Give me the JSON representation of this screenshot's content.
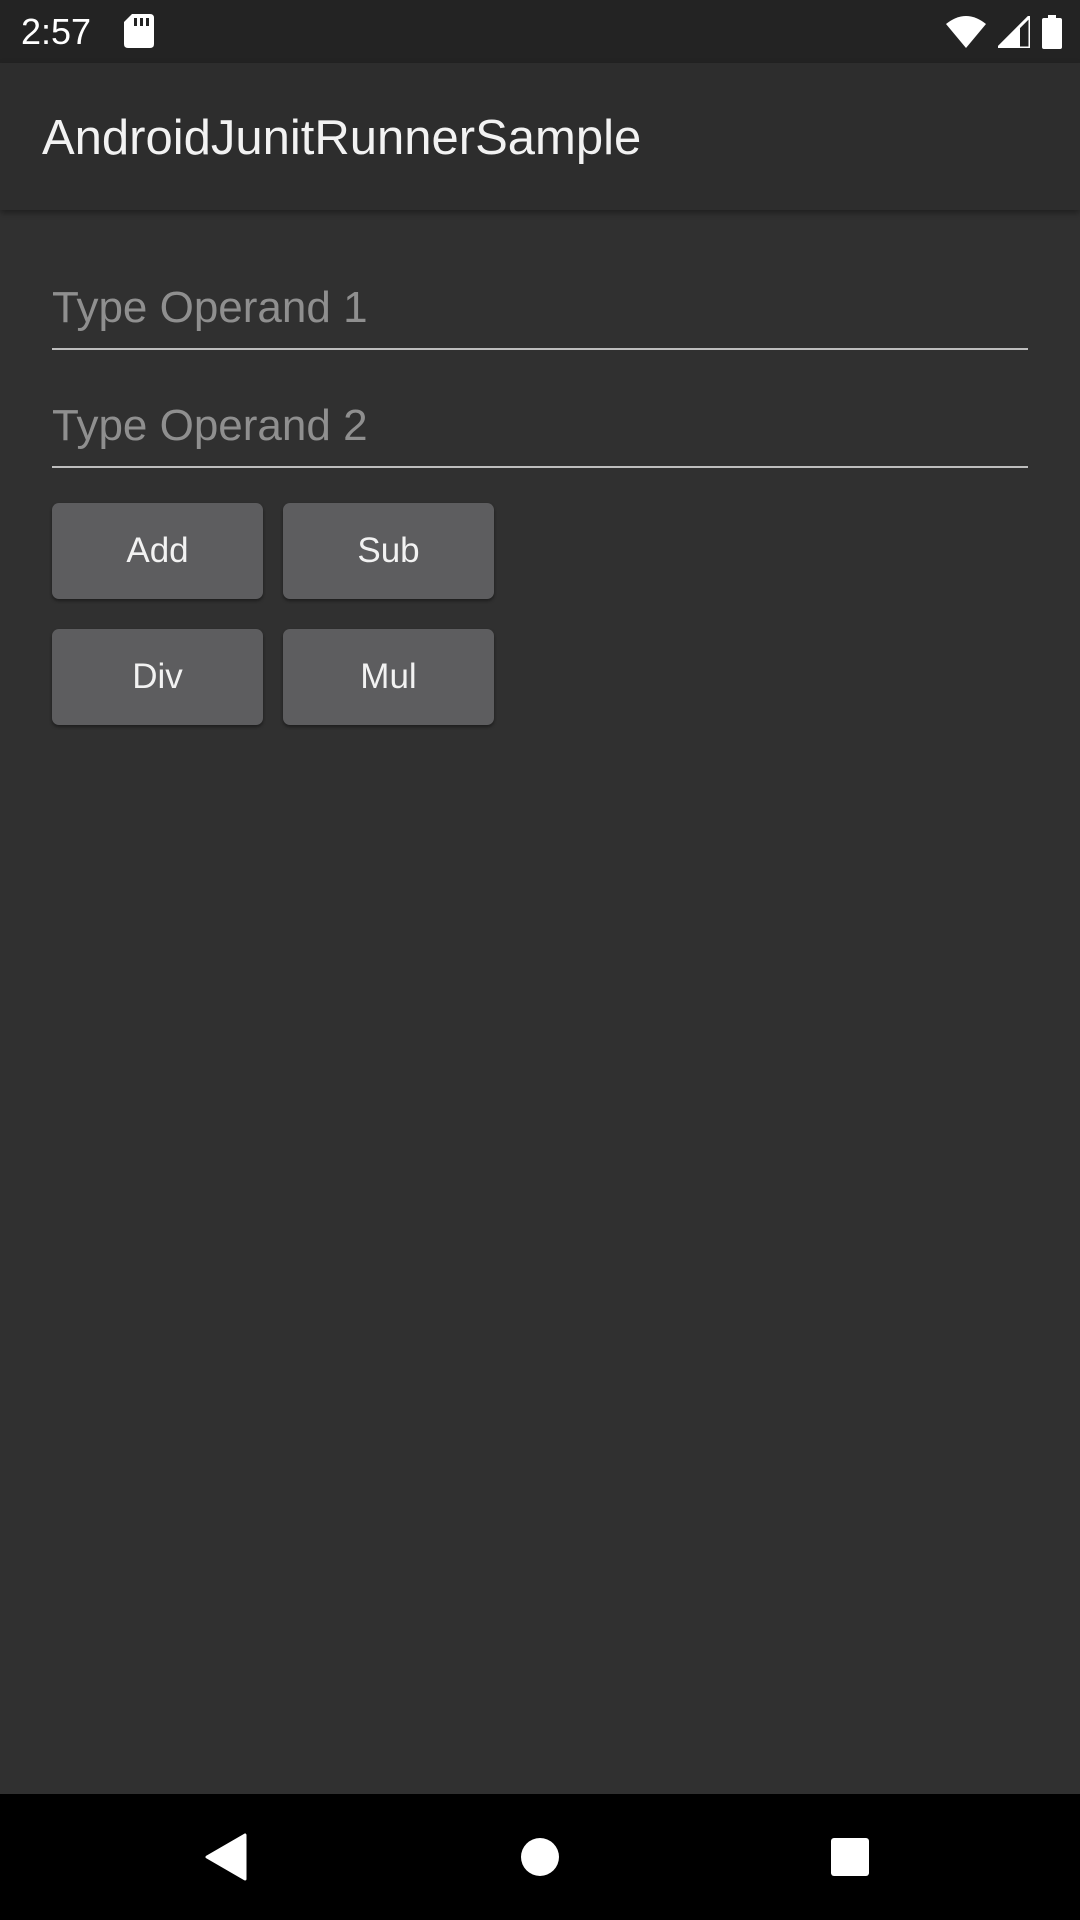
{
  "status_bar": {
    "time": "2:57",
    "icons": [
      "sd-card-icon",
      "wifi-icon",
      "signal-icon",
      "battery-icon"
    ]
  },
  "app_bar": {
    "title": "AndroidJunitRunnerSample"
  },
  "form": {
    "operand1": {
      "value": "",
      "placeholder": "Type Operand 1"
    },
    "operand2": {
      "value": "",
      "placeholder": "Type Operand 2"
    }
  },
  "buttons": {
    "add": "Add",
    "sub": "Sub",
    "div": "Div",
    "mul": "Mul"
  },
  "nav_bar": {
    "icons": [
      "back-icon",
      "home-icon",
      "recents-icon"
    ]
  },
  "colors": {
    "background": "#303030",
    "status_bar": "#232323",
    "app_bar": "#2d2d2d",
    "button": "#5d5d5f",
    "nav_bar": "#000000"
  }
}
